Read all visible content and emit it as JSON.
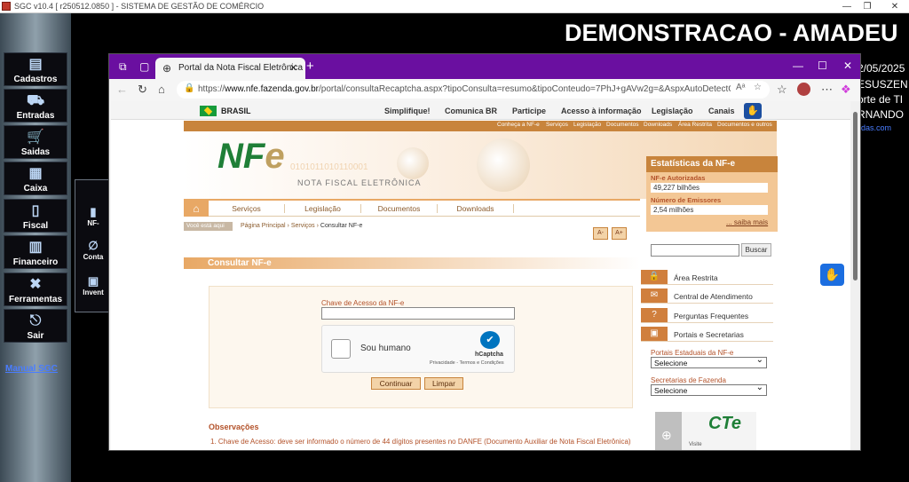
{
  "app": {
    "title": "SGC v10.4 [ r250512.0850 ] - SISTEMA DE GESTÃO DE COMÉRCIO",
    "banner": "DEMONSTRACAO - AMADEU",
    "right_lines": [
      "2/05/2025",
      "ESUSZEN",
      "orte de TI",
      "RNANDO",
      "ildas.com"
    ],
    "sidebar": [
      "Cadastros",
      "Entradas",
      "Saidas",
      "Caixa",
      "Fiscal",
      "Financeiro",
      "Ferramentas",
      "Sair"
    ],
    "manual": "Manual SGC",
    "mini_menu": [
      "NF-",
      "Conta",
      "Invent"
    ]
  },
  "browser": {
    "tab_title": "Portal da Nota Fiscal Eletrônica",
    "url_prefix": "https://",
    "url_domain": "www.nfe.fazenda.gov.br",
    "url_path": "/portal/consultaRecaptcha.aspx?tipoConsulta=resumo&tipoConteudo=7PhJ+gAVw2g=&AspxAutoDetectCooki..."
  },
  "site": {
    "country": "BRASIL",
    "gov_links": [
      "Simplifique!",
      "Comunica BR",
      "Participe",
      "Acesso à informação",
      "Legislação",
      "Canais"
    ],
    "top_menu": [
      "Conheça a NF-e",
      "Serviços",
      "Legislação",
      "Documentos",
      "Downloads",
      "Área Restrita",
      "Documentos e outros"
    ],
    "header_text": "NOTA FISCAL ELETRÔNICA",
    "binary": "0101011010110001",
    "menu": [
      "Serviços",
      "Legislação",
      "Documentos",
      "Downloads"
    ],
    "stats": {
      "title": "Estatísticas da NF-e",
      "label1": "NF-e Autorizadas",
      "value1": "49,227 bilhões",
      "label2": "Número de Emissores",
      "value2": "2,54 milhões",
      "more": "... saiba mais"
    },
    "voce_esta": "Você está aqui",
    "crumb_home": "Página Principal",
    "crumb_services": "Serviços",
    "crumb_current": "Consultar NF-e",
    "font_minus": "A-",
    "font_plus": "A+",
    "section_title": "Consultar NF-e",
    "form": {
      "key_label": "Chave de Acesso da NF-e",
      "key_value": "",
      "captcha_text": "Sou humano",
      "captcha_brand": "hCaptcha",
      "captcha_sub": "Privacidade - Termos e Condições",
      "continuar": "Continuar",
      "limpar": "Limpar"
    },
    "obs_title": "Observações",
    "obs_1": "1. Chave de Acesso: deve ser informado o número de 44 dígitos presentes no DANFE (Documento Auxiliar de Nota Fiscal Eletrônica)",
    "search_button": "Buscar",
    "right_links": [
      "Área Restrita",
      "Central de Atendimento",
      "Perguntas Frequentes",
      "Portais e Secretarias"
    ],
    "portais_label": "Portais Estaduais da NF-e",
    "portais_value": "Selecione",
    "secretarias_label": "Secretarias de Fazenda",
    "secretarias_value": "Selecione",
    "cte_visit": "Visite"
  }
}
